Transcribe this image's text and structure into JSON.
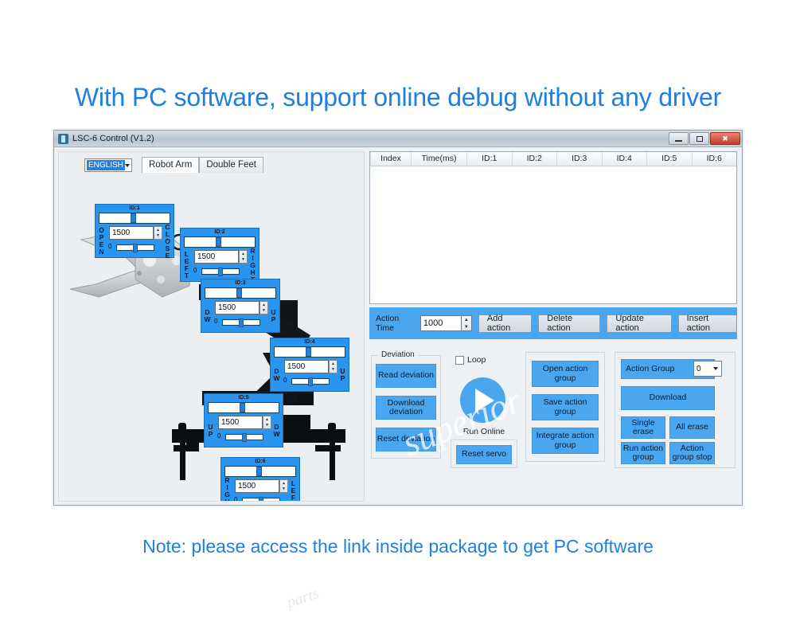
{
  "promo": {
    "top": "With PC software, support online debug without any driver",
    "bottom": "Note: please access the link inside package to get PC software",
    "heading_color": "#1f7fe0"
  },
  "window": {
    "title": "LSC-6 Control (V1.2)",
    "minimize_label": "Minimize",
    "maximize_label": "Maximize",
    "close_label": "Close"
  },
  "arm_panel": {
    "language": {
      "value": "ENGLISH"
    },
    "tabs": [
      {
        "label": "Robot Arm",
        "active": true
      },
      {
        "label": "Double Feet",
        "active": false
      }
    ],
    "status_led": {
      "name": "power-led",
      "color": "#c2120c"
    },
    "servos": [
      {
        "id": "ID:1",
        "value": "1500",
        "min": "0",
        "left": "OPEN",
        "right": "CLOSE"
      },
      {
        "id": "ID:2",
        "value": "1500",
        "min": "0",
        "left": "LEFT",
        "right": "RIGHT"
      },
      {
        "id": "ID:3",
        "value": "1500",
        "min": "0",
        "left": "DW",
        "right": "UP"
      },
      {
        "id": "ID:4",
        "value": "1500",
        "min": "0",
        "left": "DW",
        "right": "UP"
      },
      {
        "id": "ID:5",
        "value": "1500",
        "min": "0",
        "left": "UP",
        "right": "DW"
      },
      {
        "id": "ID:6",
        "value": "1500",
        "min": "0",
        "left": "RIGHT",
        "right": "LEFT"
      }
    ]
  },
  "table": {
    "columns": [
      "Index",
      "Time(ms)",
      "ID:1",
      "ID:2",
      "ID:3",
      "ID:4",
      "ID:5",
      "ID:6"
    ],
    "rows": []
  },
  "action_bar": {
    "time_label": "Action Time",
    "time_value": "1000",
    "buttons": [
      "Add action",
      "Delete action",
      "Update action",
      "Insert action"
    ]
  },
  "deviation": {
    "group_title": "Deviation",
    "buttons": [
      "Read deviation",
      "Download deviation",
      "Reset deviation"
    ]
  },
  "run": {
    "loop_label": "Loop",
    "loop_checked": false,
    "play_label": "Run Online",
    "reset_servo_label": "Reset servo"
  },
  "action_group": {
    "buttons": [
      "Open action group",
      "Save action group",
      "Integrate action group"
    ]
  },
  "download_panel": {
    "group_label": "Action Group",
    "group_value": "0",
    "download_label": "Download",
    "single_erase_label": "Single erase",
    "all_erase_label": "All erase",
    "run_group_label": "Run action group",
    "stop_group_label": "Action group stop"
  },
  "watermark": {
    "main": "superior",
    "sub": "parts"
  }
}
